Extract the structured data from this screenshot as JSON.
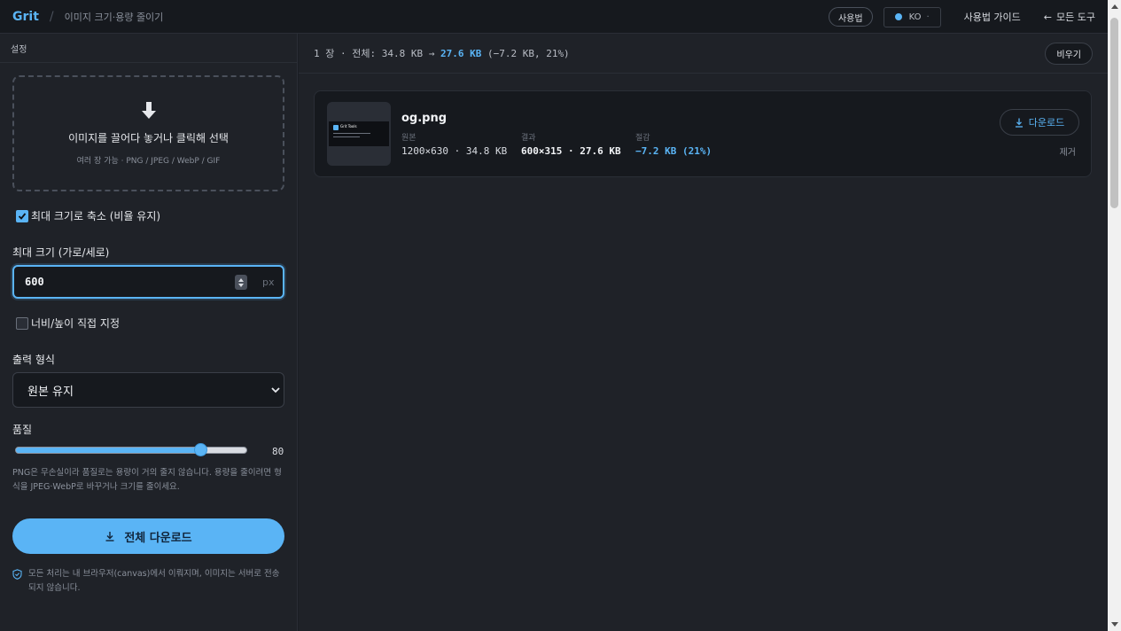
{
  "header": {
    "brand": "Grit",
    "separator": "/",
    "subtitle": "이미지 크기·용량 줄이기",
    "usage_button": "사용법",
    "language": "KO",
    "guide_link": "사용법 가이드",
    "all_tools_link": "모든 도구"
  },
  "sidebar": {
    "title": "설정",
    "dropzone": {
      "title": "이미지를 끌어다 놓거나 클릭해 선택",
      "hint": "여러 장 가능 · PNG / JPEG / WebP / GIF"
    },
    "fit_max_checkbox": {
      "label": "최대 크기로 축소 (비율 유지)",
      "checked": true
    },
    "max_size": {
      "label": "최대 크기 (가로/세로)",
      "value": "600",
      "unit": "px"
    },
    "custom_size_checkbox": {
      "label": "너비/높이 직접 지정",
      "checked": false
    },
    "format": {
      "label": "출력 형식",
      "selected": "원본 유지"
    },
    "quality": {
      "label": "품질",
      "value": "80",
      "level": 0.8
    },
    "note": "PNG은 무손실이라 품질로는 용량이 거의 줄지 않습니다. 용량을 줄이려면 형식을 JPEG·WebP로 바꾸거나 크기를 줄이세요.",
    "download_all_label": "전체 다운로드",
    "privacy_note": "모든 처리는 내 브라우저(canvas)에서 이뤄지며, 이미지는 서버로 전송되지 않습니다."
  },
  "summary": {
    "count": "1 장",
    "dot": "·",
    "total_label": "전체:",
    "original": "34.8 KB",
    "arrow": "→",
    "result": "27.6 KB",
    "saved": "(−7.2 KB, 21%)",
    "clear_label": "비우기"
  },
  "files": [
    {
      "name": "og.png",
      "thumb_title": "Grit Tools",
      "original_label": "원본",
      "original_value": "1200×630 · 34.8 KB",
      "result_label": "결과",
      "result_value": "600×315 · 27.6 KB",
      "saved_label": "절감",
      "saved_value": "−7.2 KB (21%)",
      "download_label": "다운로드",
      "remove_label": "제거"
    }
  ],
  "colors": {
    "accent": "#5ab4f5",
    "background": "#1a1d23",
    "panel": "#1f2228",
    "card": "#16191e"
  },
  "icons": {
    "drop": "down-arrow-icon",
    "download": "download-icon",
    "shield": "shield-icon",
    "globe": "globe-icon",
    "back": "left-arrow-icon"
  }
}
